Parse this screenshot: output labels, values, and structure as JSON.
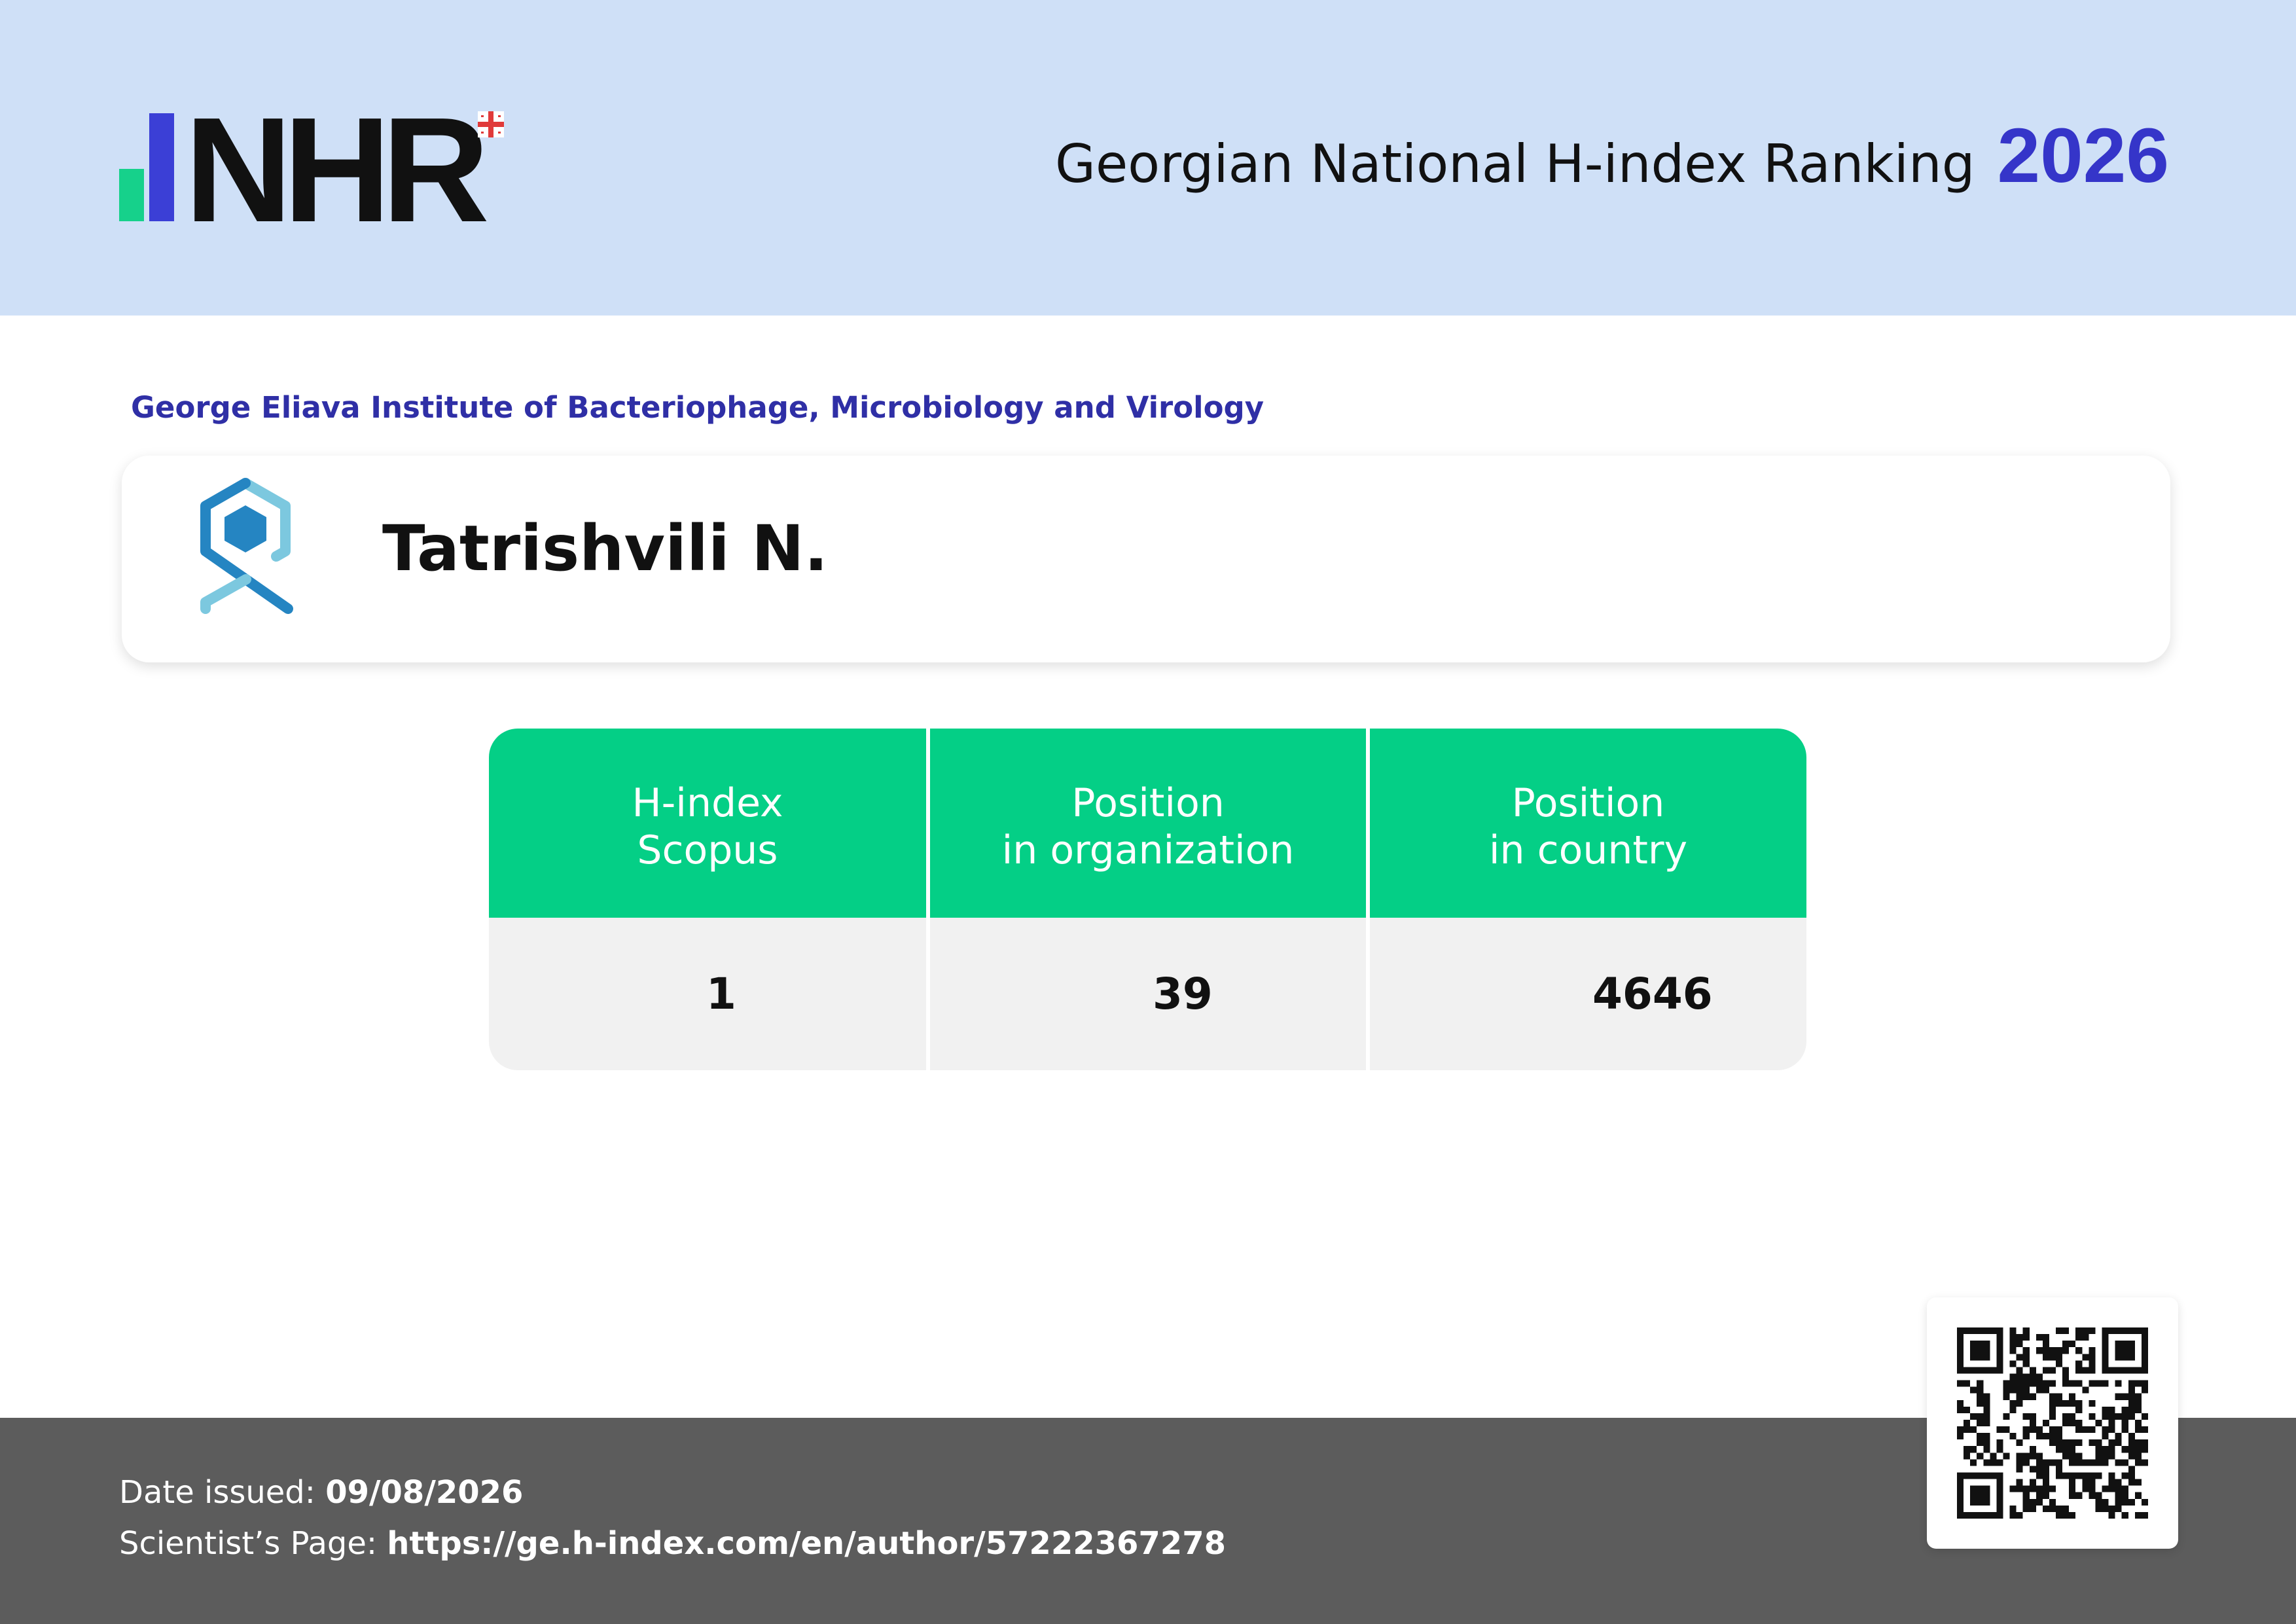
{
  "header": {
    "logo_text": "NHR",
    "title": "Georgian National H-index Ranking",
    "year": "2026",
    "colors": {
      "background": "#cfe0f7",
      "accent": "#3535c9",
      "green": "#16d18b"
    }
  },
  "organization": "George Eliava Institute of Bacteriophage, Microbiology and Virology",
  "scientist": {
    "name": "Tatrishvili N.",
    "institution_logo_icon": "hexagon-chain-logo-icon"
  },
  "stats": {
    "headers": [
      [
        "H-index",
        "Scopus"
      ],
      [
        "Position",
        "in organization"
      ],
      [
        "Position",
        "in country"
      ]
    ],
    "values": [
      "1",
      "39",
      "4646"
    ],
    "header_color": "#04cf86"
  },
  "footer": {
    "date_label": "Date issued:",
    "date_value": "09/08/2026",
    "page_label": "Scientist’s Page:",
    "page_value": "https://ge.h-index.com/en/author/57222367278"
  },
  "qr_icon": "qr-code-icon"
}
